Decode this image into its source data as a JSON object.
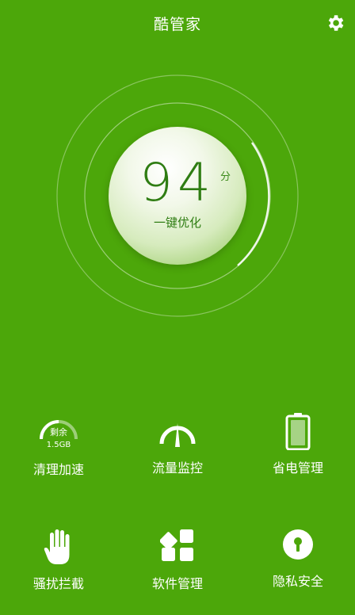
{
  "header": {
    "title": "酷管家",
    "settings_icon": "gear-icon"
  },
  "score": {
    "value": "94",
    "unit": "分",
    "action": "一键优化"
  },
  "tools": [
    {
      "label": "清理加速",
      "icon": "memory-gauge-icon",
      "gauge_label": "剩余",
      "gauge_value": "1.5GB"
    },
    {
      "label": "流量监控",
      "icon": "speedometer-icon"
    },
    {
      "label": "省电管理",
      "icon": "battery-icon"
    },
    {
      "label": "骚扰拦截",
      "icon": "hand-icon"
    },
    {
      "label": "软件管理",
      "icon": "apps-grid-icon"
    },
    {
      "label": "隐私安全",
      "icon": "keyhole-icon"
    }
  ],
  "colors": {
    "background": "#4ca70a",
    "score_text": "#2f7d13"
  }
}
